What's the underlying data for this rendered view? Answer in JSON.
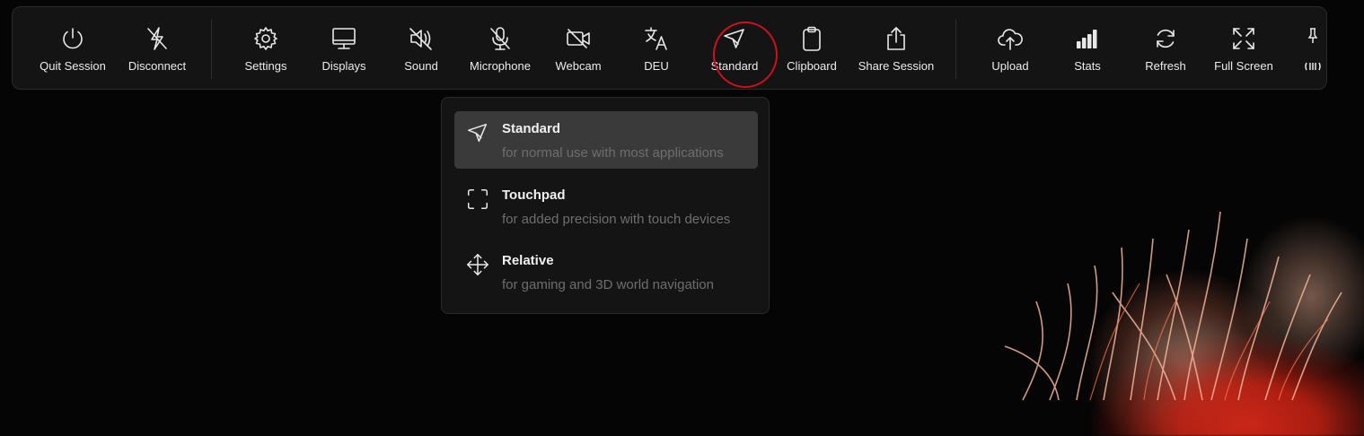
{
  "toolbar": {
    "items": [
      {
        "label": "Quit Session",
        "icon": "power-icon"
      },
      {
        "label": "Disconnect",
        "icon": "disconnect-icon"
      },
      {
        "label": "Settings",
        "icon": "gear-icon"
      },
      {
        "label": "Displays",
        "icon": "monitor-icon"
      },
      {
        "label": "Sound",
        "icon": "speaker-muted-icon"
      },
      {
        "label": "Microphone",
        "icon": "microphone-off-icon"
      },
      {
        "label": "Webcam",
        "icon": "webcam-off-icon"
      },
      {
        "label": "DEU",
        "icon": "translate-icon"
      },
      {
        "label": "Standard",
        "icon": "cursor-arrow-icon"
      },
      {
        "label": "Clipboard",
        "icon": "clipboard-icon"
      },
      {
        "label": "Share Session",
        "icon": "share-icon"
      },
      {
        "label": "Upload",
        "icon": "cloud-upload-icon"
      },
      {
        "label": "Stats",
        "icon": "signal-bars-icon"
      },
      {
        "label": "Refresh",
        "icon": "refresh-icon"
      },
      {
        "label": "Full Screen",
        "icon": "fullscreen-icon"
      }
    ],
    "highlight_color": "#d0101a"
  },
  "mouse_menu": {
    "options": [
      {
        "title": "Standard",
        "subtitle": "for normal use with most applications",
        "icon": "cursor-arrow-icon",
        "selected": true
      },
      {
        "title": "Touchpad",
        "subtitle": "for added precision with touch devices",
        "icon": "touchpad-frame-icon",
        "selected": false
      },
      {
        "title": "Relative",
        "subtitle": "for gaming and 3D world navigation",
        "icon": "move-arrows-icon",
        "selected": false
      }
    ]
  }
}
